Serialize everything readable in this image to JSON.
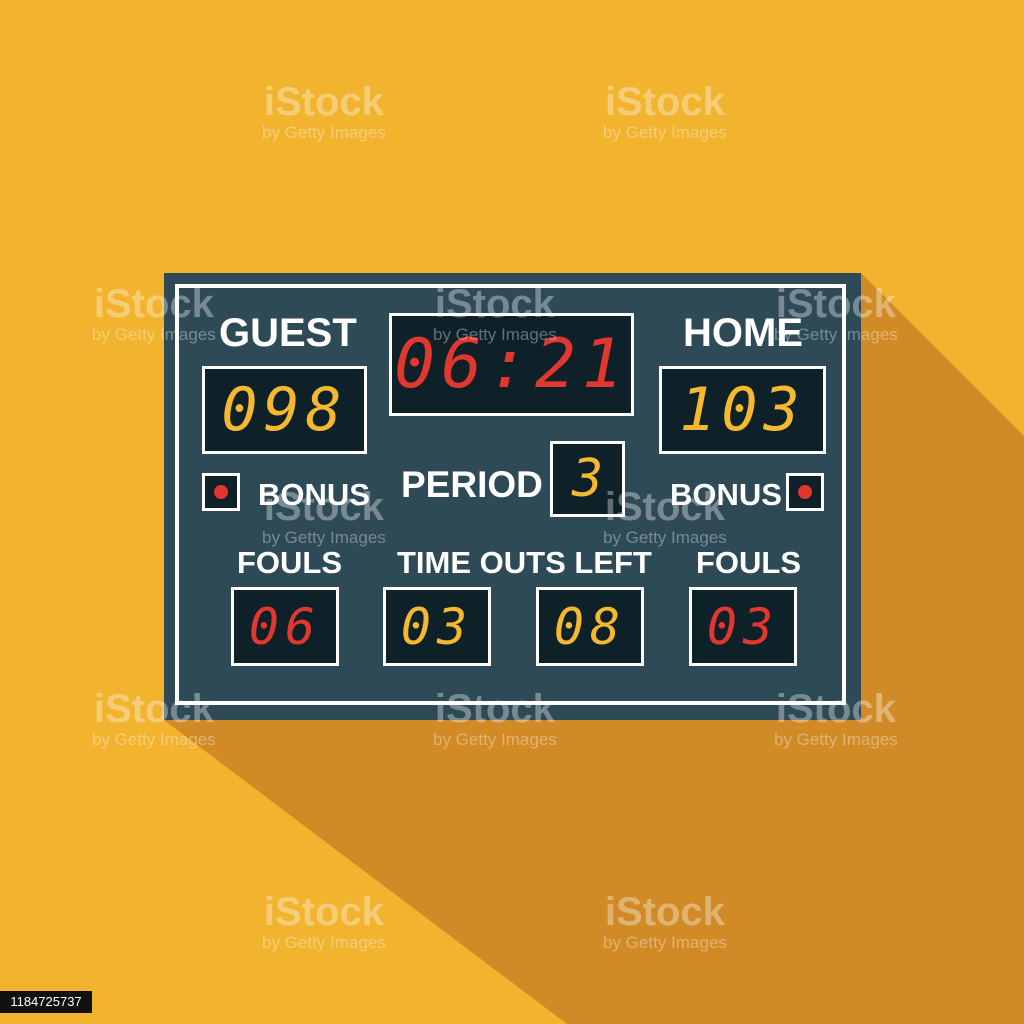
{
  "colors": {
    "background": "#F2B32E",
    "shadow": "#D08A26",
    "board": "#2E4A56",
    "display": "#0E2129",
    "red_digits": "#E2372E",
    "yellow_digits": "#F5B82E",
    "frame": "#FFFFFF"
  },
  "scoreboard": {
    "guest_label": "GUEST",
    "home_label": "HOME",
    "guest_score": "098",
    "home_score": "103",
    "clock": "06:21",
    "period_label": "PERIOD",
    "period": "3",
    "bonus_left_label": "BONUS",
    "bonus_right_label": "BONUS",
    "fouls_left_label": "FOULS",
    "fouls_right_label": "FOULS",
    "timeouts_label": "TIME OUTS LEFT",
    "guest_fouls": "06",
    "guest_timeouts": "03",
    "home_timeouts": "08",
    "home_fouls": "03"
  },
  "watermark": {
    "brand": "iStock",
    "credit": "by Getty Images",
    "image_id": "1184725737"
  }
}
